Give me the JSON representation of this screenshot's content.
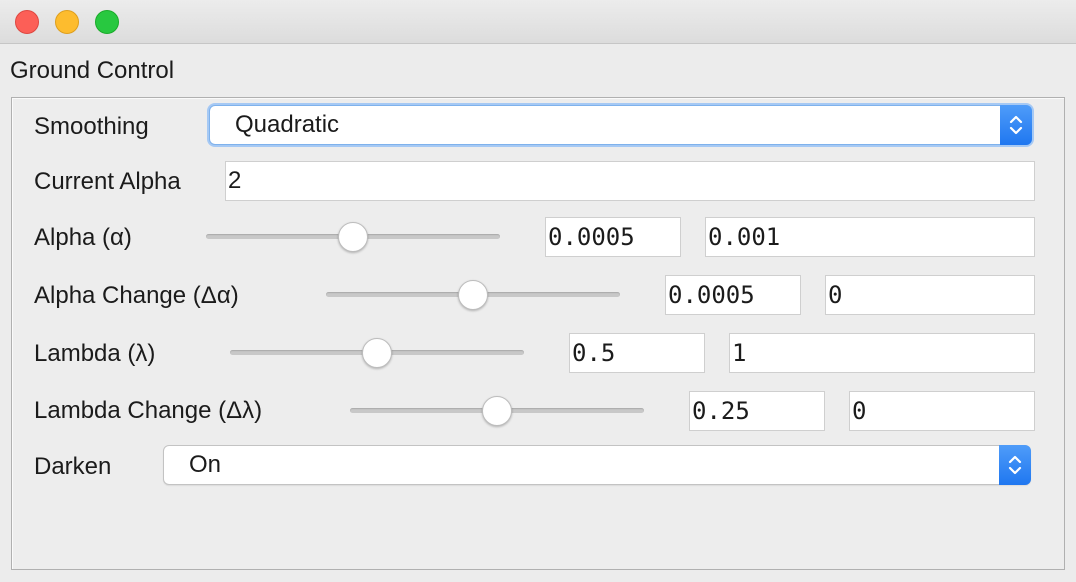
{
  "window": {
    "title": ""
  },
  "panel": {
    "title": "Ground Control",
    "smoothing": {
      "label": "Smoothing",
      "value": "Quadratic"
    },
    "current_alpha": {
      "label": "Current Alpha",
      "value": "2"
    },
    "params": [
      {
        "label": "Alpha (α)",
        "step": "0.0005",
        "value": "0.001",
        "slider_fraction": 0.5
      },
      {
        "label": "Alpha Change (Δα)",
        "step": "0.0005",
        "value": "0",
        "slider_fraction": 0.5
      },
      {
        "label": "Lambda (λ)",
        "step": "0.5",
        "value": "1",
        "slider_fraction": 0.5
      },
      {
        "label": "Lambda Change (Δλ)",
        "step": "0.25",
        "value": "0",
        "slider_fraction": 0.5
      }
    ],
    "darken": {
      "label": "Darken",
      "value": "On"
    }
  },
  "colors": {
    "accent": "#2b84f5",
    "focus_ring": "#a6c9f4",
    "close": "#fc5f57",
    "minimize": "#fdbc2e",
    "zoom": "#28c840"
  }
}
